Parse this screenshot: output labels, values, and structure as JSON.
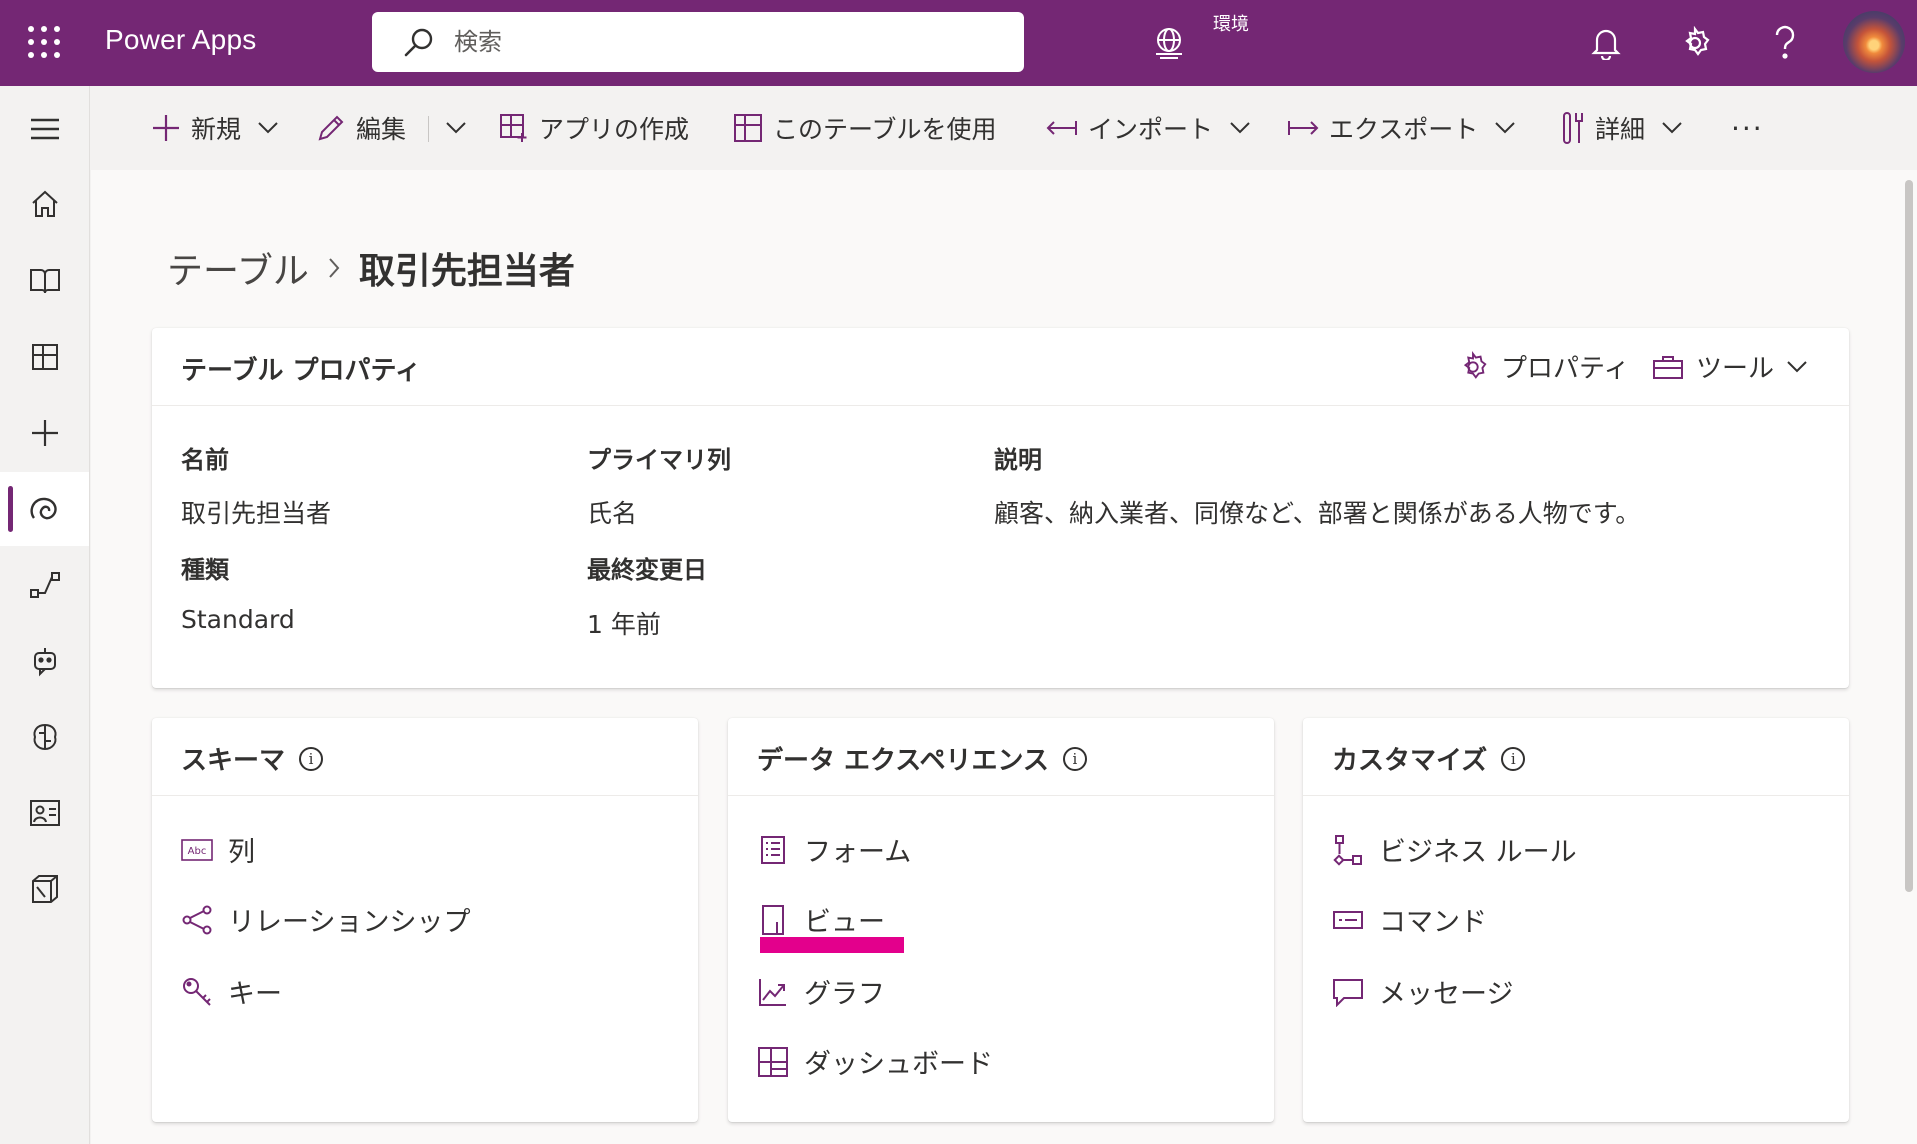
{
  "topbar": {
    "app_title": "Power Apps",
    "search_placeholder": "検索",
    "environment_label": "環境",
    "brand_color": "#742774"
  },
  "rail": {
    "items": [
      {
        "name": "menu-icon"
      },
      {
        "name": "home-icon"
      },
      {
        "name": "learn-icon"
      },
      {
        "name": "apps-icon"
      },
      {
        "name": "create-icon"
      },
      {
        "name": "dataverse-icon",
        "active": true
      },
      {
        "name": "flows-icon"
      },
      {
        "name": "chatbots-icon"
      },
      {
        "name": "ai-builder-icon"
      },
      {
        "name": "portals-icon"
      },
      {
        "name": "solutions-icon"
      }
    ]
  },
  "commandbar": {
    "new_label": "新規",
    "edit_label": "編集",
    "create_app_label": "アプリの作成",
    "use_table_label": "このテーブルを使用",
    "import_label": "インポート",
    "export_label": "エクスポート",
    "details_label": "詳細",
    "more_label": "···"
  },
  "breadcrumb": {
    "parent": "テーブル",
    "separator": "›",
    "current": "取引先担当者"
  },
  "properties_card": {
    "title": "テーブル プロパティ",
    "properties_action": "プロパティ",
    "tools_action": "ツール",
    "fields": {
      "name_label": "名前",
      "name_value": "取引先担当者",
      "primary_label": "プライマリ列",
      "primary_value": "氏名",
      "description_label": "説明",
      "description_value": "顧客、納入業者、同僚など、部署と関係がある人物です。",
      "type_label": "種類",
      "type_value": "Standard",
      "modified_label": "最終変更日",
      "modified_value": "1 年前"
    }
  },
  "schema_card": {
    "title": "スキーマ",
    "items": [
      "列",
      "リレーションシップ",
      "キー"
    ]
  },
  "data_experiences_card": {
    "title": "データ エクスペリエンス",
    "items": [
      "フォーム",
      "ビュー",
      "グラフ",
      "ダッシュボード"
    ],
    "highlighted_item": "ビュー",
    "highlight_color": "#e3008c"
  },
  "customize_card": {
    "title": "カスタマイズ",
    "items": [
      "ビジネス ルール",
      "コマンド",
      "メッセージ"
    ]
  }
}
